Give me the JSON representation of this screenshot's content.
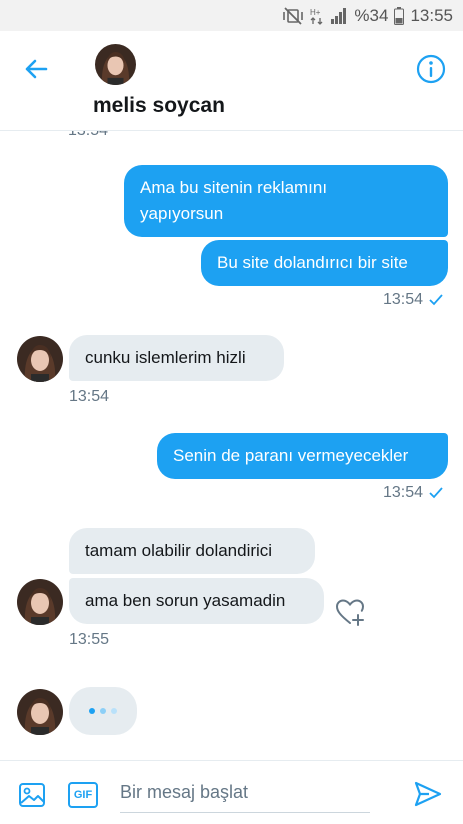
{
  "status_bar": {
    "battery_text": "%34",
    "time": "13:55",
    "icons": [
      "vibrate-mute-icon",
      "data-icon",
      "signal-icon",
      "battery-icon"
    ]
  },
  "header": {
    "contact_name": "melis soycan",
    "back_icon": "arrow-left-icon",
    "info_icon": "info-icon",
    "accent": "#1da1f2"
  },
  "conversation": {
    "cut_timestamp": "13:54",
    "outgoing_group_1": {
      "messages": [
        "Ama bu sitenin reklamını yapıyorsun",
        "Bu site dolandırıcı bir site"
      ],
      "line1": "Ama bu sitenin reklamını",
      "line2": "yapıyorsun",
      "time": "13:54",
      "status_icon": "check-icon"
    },
    "incoming_1": {
      "text": "cunku islemlerim hizli",
      "time": "13:54"
    },
    "outgoing_2": {
      "text": "Senin de paranı vermeyecekler",
      "time": "13:54",
      "status_icon": "check-icon"
    },
    "incoming_group_2": {
      "messages": [
        "tamam olabilir dolandirici",
        "ama ben sorun yasamadin"
      ],
      "time": "13:55",
      "reaction_icon": "heart-plus-icon"
    },
    "typing_indicator": true
  },
  "compose": {
    "placeholder": "Bir mesaj başlat",
    "gif_label": "GIF",
    "media_icon": "image-icon",
    "send_icon": "send-icon"
  },
  "colors": {
    "outgoing_bubble": "#1da1f2",
    "incoming_bubble": "#e6ecf0",
    "meta_text": "#657786"
  }
}
